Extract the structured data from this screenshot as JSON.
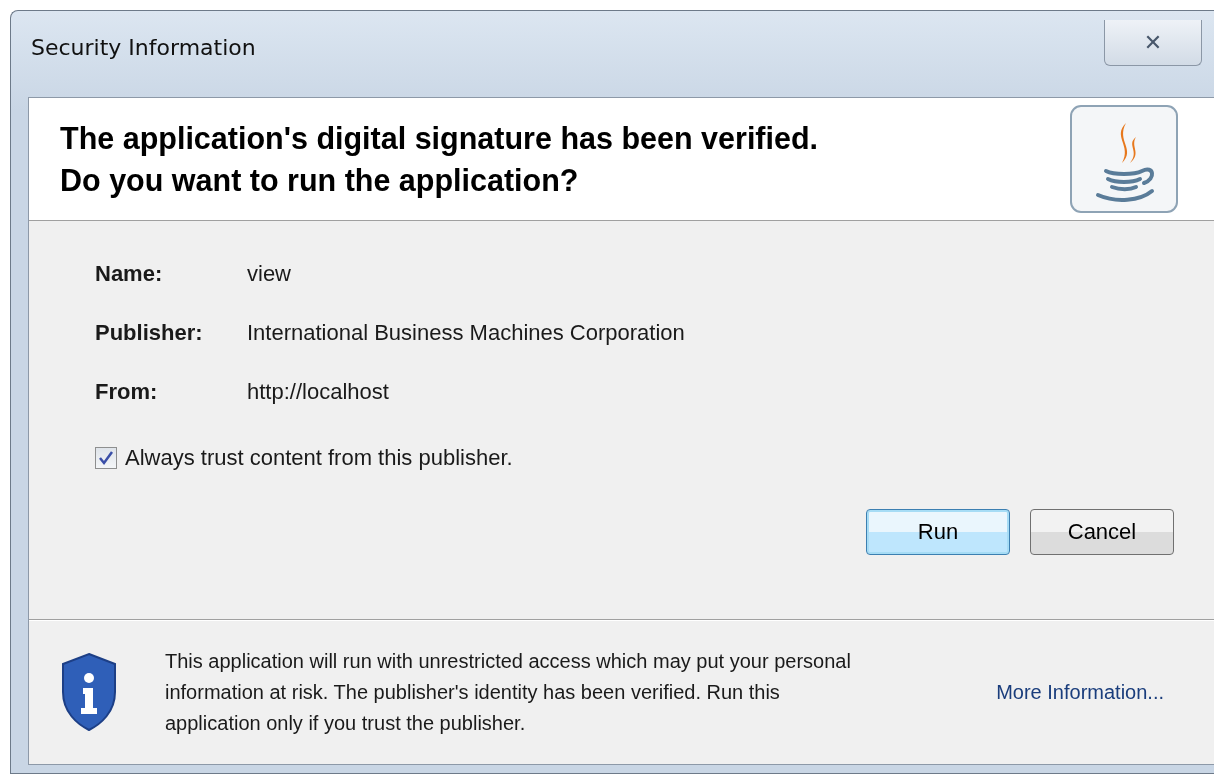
{
  "window": {
    "title": "Security Information",
    "close_button": "✕"
  },
  "header": {
    "lines": [
      "The application's digital signature has been verified.",
      "Do you want to run the application?"
    ]
  },
  "fields": [
    {
      "label": "Name:",
      "value": "view"
    },
    {
      "label": "Publisher:",
      "value": "International Business Machines Corporation"
    },
    {
      "label": "From:",
      "value": "http://localhost"
    }
  ],
  "checkbox": {
    "label": "Always trust content from this publisher.",
    "checked": true
  },
  "buttons": [
    {
      "label": "Run",
      "default": true
    },
    {
      "label": "Cancel",
      "default": false
    }
  ],
  "footer": {
    "message": "This application will run with unrestricted access which may put your personal information at risk. The publisher's identity has been verified. Run this application only if you trust the publisher.",
    "link": "More Information..."
  }
}
